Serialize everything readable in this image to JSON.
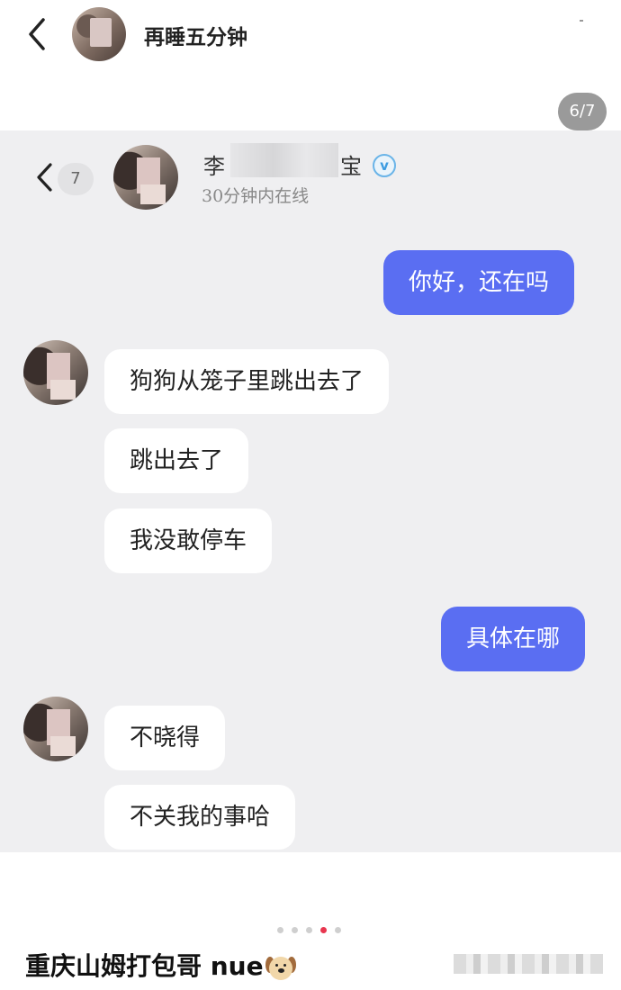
{
  "header": {
    "title": "再睡五分钟",
    "back_icon": "chevron-left-icon"
  },
  "viewer": {
    "counter": "6/7",
    "page_dots": {
      "total": 5,
      "active_index": 3
    }
  },
  "chat_screenshot": {
    "unread_count": "7",
    "contact_name_start": "李",
    "contact_name_end": "宝",
    "contact_name_obscured": true,
    "verified_icon": "verified-v-badge-icon",
    "status": "30分钟内在线",
    "messages": [
      {
        "direction": "out",
        "text": "你好，还在吗"
      },
      {
        "direction": "in",
        "text": "狗狗从笼子里跳出去了"
      },
      {
        "direction": "in",
        "text": "跳出去了"
      },
      {
        "direction": "in",
        "text": "我没敢停车"
      },
      {
        "direction": "out",
        "text": "具体在哪"
      },
      {
        "direction": "in",
        "text": "不晓得"
      },
      {
        "direction": "in",
        "text": "不关我的事哈"
      }
    ]
  },
  "post": {
    "caption": "重庆山姆打包哥 nue",
    "caption_emoji": "dog-face-icon"
  },
  "colors": {
    "outgoing_bubble": "#5a6ef2",
    "incoming_bubble": "#ffffff",
    "chat_background": "#efeff1",
    "active_dot": "#e8364f",
    "verified": "#3d9ce0"
  }
}
